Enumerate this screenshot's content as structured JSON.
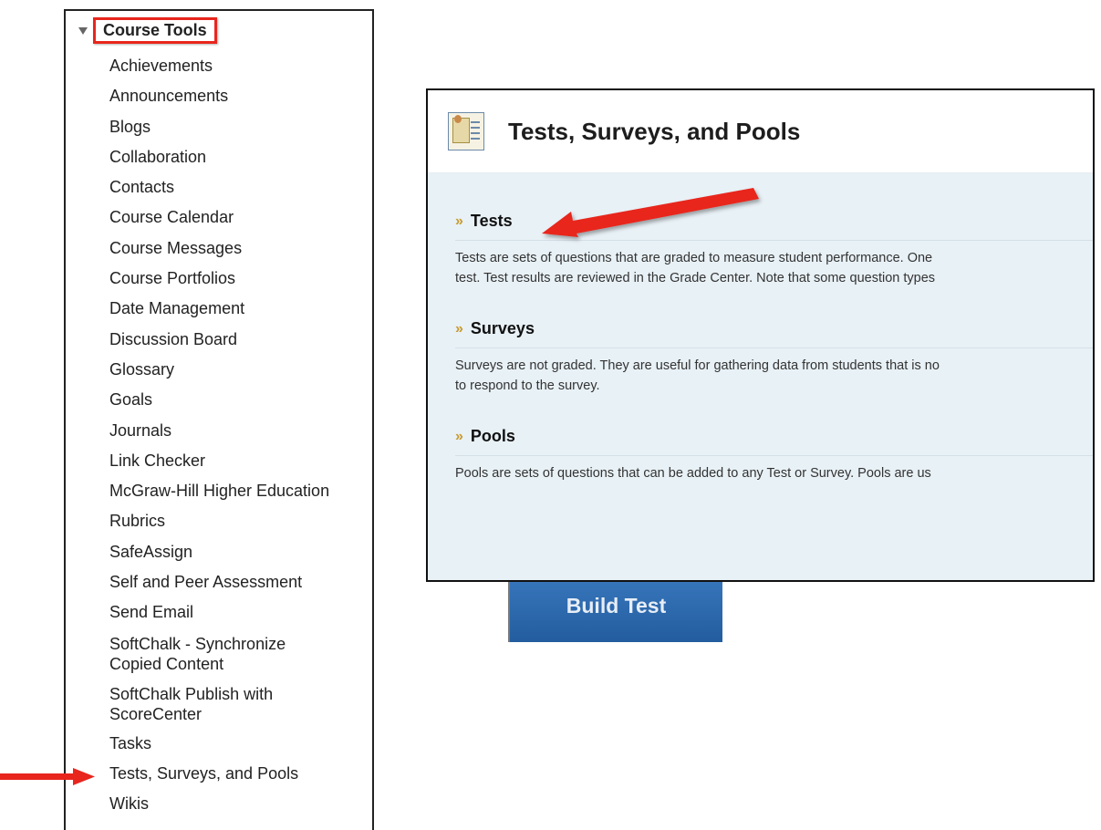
{
  "tools_panel": {
    "title": "Course Tools",
    "items": [
      "Achievements",
      "Announcements",
      "Blogs",
      "Collaboration",
      "Contacts",
      "Course Calendar",
      "Course Messages",
      "Course Portfolios",
      "Date Management",
      "Discussion Board",
      "Glossary",
      "Goals",
      "Journals",
      "Link Checker",
      "McGraw-Hill Higher Education",
      "Rubrics",
      "SafeAssign",
      "Self and Peer Assessment",
      "Send Email",
      "SoftChalk - Synchronize Copied Content",
      "SoftChalk Publish with ScoreCenter",
      "Tasks",
      "Tests, Surveys, and Pools",
      "Wikis"
    ]
  },
  "card": {
    "title": "Tests, Surveys, and Pools",
    "sections": [
      {
        "heading": "Tests",
        "line1": "Tests are sets of questions that are graded to measure student performance. One",
        "line2": "test. Test results are reviewed in the Grade Center. Note that some question types"
      },
      {
        "heading": "Surveys",
        "line1": "Surveys are not graded. They are useful for gathering data from students that is no",
        "line2": "to respond to the survey."
      },
      {
        "heading": "Pools",
        "line1": "Pools are sets of questions that can be added to any Test or Survey. Pools are us",
        "line2": ""
      }
    ]
  },
  "build_test_label": "Build Test",
  "annotation_color": "#e8261d"
}
